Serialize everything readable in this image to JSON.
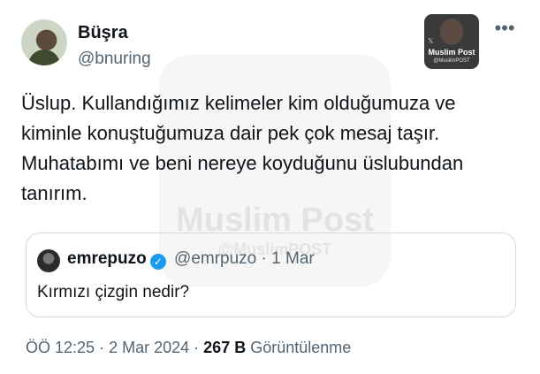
{
  "author": {
    "display_name": "Büşra",
    "handle": "@bnuring"
  },
  "watermark": {
    "badge_title": "Muslim Post",
    "badge_sub": "@MuslimPOST",
    "big_text": "Muslim Post",
    "big_sub": "@MuslimPOST"
  },
  "tweet": {
    "text": "Üslup. Kullandığımız kelimeler kim olduğumuza ve kiminle konuştuğumuza dair pek çok mesaj taşır. Muhatabımı ve beni nereye koyduğunu üslubundan tanırım."
  },
  "quote": {
    "display_name": "emrepuzo",
    "handle": "@emrpuzo",
    "separator": "·",
    "date": "1 Mar",
    "text": "Kırmızı çizgin nedir?"
  },
  "meta": {
    "time": "ÖÖ 12:25",
    "separator": "·",
    "date": "2 Mar 2024",
    "views_count": "267 B",
    "views_label": "Görüntülenme"
  },
  "colors": {
    "text": "#0f1419",
    "secondary": "#536471",
    "verified": "#1d9bf0",
    "border": "#cfd9de"
  }
}
